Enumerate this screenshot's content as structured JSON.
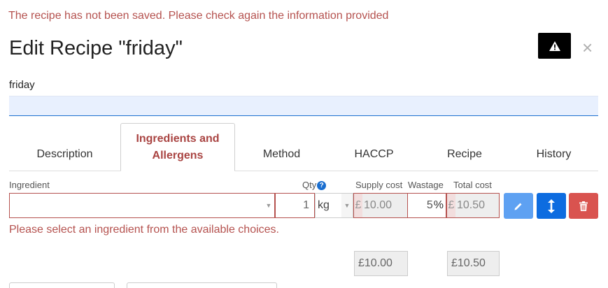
{
  "messages": {
    "save_error": "The recipe has not been saved. Please check again the information provided",
    "ingredient_error": "Please select an ingredient from the available choices."
  },
  "header": {
    "title": "Edit Recipe \"friday\"",
    "close_glyph": "×",
    "warning_icon": "warning-triangle-icon"
  },
  "recipe_name": {
    "value": "friday"
  },
  "tabs": [
    {
      "label": "Description",
      "active": false
    },
    {
      "label": "Ingredients and Allergens",
      "active": true
    },
    {
      "label": "Method",
      "active": false
    },
    {
      "label": "HACCP",
      "active": false
    },
    {
      "label": "Recipe",
      "active": false
    },
    {
      "label": "History",
      "active": false
    }
  ],
  "ingredient_row": {
    "labels": {
      "ingredient": "Ingredient",
      "qty": "Qty",
      "qty_help": "?",
      "supply_cost": "Supply cost",
      "wastage": "Wastage",
      "total_cost": "Total cost"
    },
    "ingredient_value": "",
    "qty": "1",
    "unit": "kg",
    "currency": "£",
    "supply_cost": "10.00",
    "wastage": "5",
    "wastage_unit": "%",
    "total_cost": "10.50",
    "buttons": {
      "edit_icon": "pencil-icon",
      "move_icon": "vertical-arrows-icon",
      "delete_icon": "trash-icon"
    }
  },
  "totals": {
    "supply_cost": "£10.00",
    "total_cost": "£10.50"
  },
  "colors": {
    "error": "#b5524f",
    "active_tab": "#a94442",
    "primary": "#0d6ce0",
    "edit": "#5ea1f2",
    "danger": "#d9534f"
  }
}
